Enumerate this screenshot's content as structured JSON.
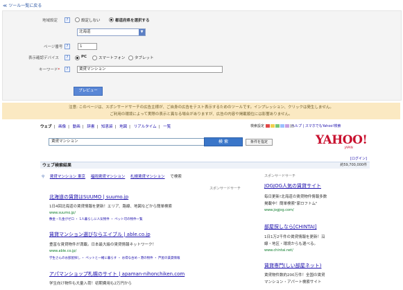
{
  "top_link": "≪ ツール一覧に戻る",
  "form": {
    "region_label": "地域設定",
    "region_opt_none": "設定しない",
    "region_opt_select": "都道府県を選択する",
    "prefecture_value": "北海道",
    "page_label": "ページ番号",
    "page_value": "1",
    "device_label": "表示確認デバイス",
    "device_pc": "PC",
    "device_sp": "スマートフォン",
    "device_tab": "タブレット",
    "keyword_label": "キーワード",
    "keyword_required": "*",
    "keyword_value": "賃貸マンション",
    "preview_button": "プレビュー",
    "help_glyph": "?"
  },
  "notice": {
    "line1": "注意: このページは、スポンサードサーチの広告主様が、ご自身の広告をテスト表示するためのツールです。インプレッション、クリックは発生しません。",
    "line2": "ご利用の環境によって実際の表示と異なる場合がありますが、広告の内容や掲載順位には影響ありません。"
  },
  "yahoo": {
    "tabs": [
      "ウェブ",
      "画像",
      "動画",
      "辞書",
      "知恵袋",
      "地図",
      "リアルタイム",
      "一覧"
    ],
    "settings_label": "検索設定",
    "swatch_colors": [
      "#e04848",
      "#f0d050",
      "#78c878",
      "#9ac0ff",
      "#c8a0e0",
      "#c8c8c8"
    ],
    "header_links": [
      "ヘルプ",
      "スマホでもYahoo!検索"
    ],
    "search_value": "賃貸マンション",
    "search_button": "検 索",
    "condition_button": "条件を指定",
    "logo_text": "YAHOO!",
    "logo_sub": "JAPAN",
    "login_link": "[ログイン]",
    "results_title": "ウェブ検索結果",
    "results_count": "約59,700,000件",
    "related_icon": "search-icon",
    "related": [
      "賃貸マンション 東京",
      "福岡賃貸マンション",
      "札幌賃貸マンション",
      "で検索"
    ],
    "sponsor_label": "スポンサードサーチ",
    "ads": [
      {
        "title": "北海道の賃貸はSUUMO | suumo.jp",
        "desc": "1日4回北海道の賃貸情報を更新！エリア、路線、地図などから簡単検索",
        "url": "www.suumo.jp/",
        "sub": "敷金・礼金がゼロ ・ 1人暮らしに人気物件 ・ ペット可の物件一覧"
      },
      {
        "title": "賃貸マンション選びならエイブル | able.co.jp",
        "desc": "豊富な賃貸物件が満載。日本最大級の賃貸情報ネットワーク！",
        "url": "www.able.co.jp/",
        "sub": "学生さんのお部屋探し ・ ペットと一緒に暮らす ・ お得な古め・港の物件 ・ 芦屋の賃貸情報"
      },
      {
        "title": "アパマンショップ札幌のサイト | apaman-nihonchiken.com",
        "desc": "学生向け物件も大量入荷！初期費用も2万円から",
        "url": "",
        "sub": ""
      }
    ],
    "right_label": "スポンサードサーチ",
    "right_ads": [
      {
        "title": "JOGJOG人気の賃貸サイト",
        "desc1": "毎日更新!北海道の賃貸物件情報多数",
        "desc2": "掲載中！簡単検索\"家ロフトム\"",
        "url": "www.jogjog.com/"
      },
      {
        "title": "部屋探しなら[CHINTAI]",
        "desc1": "1日1万2千件の賃貸情報を更新！沿",
        "desc2": "線・地区・環境からも選べる。",
        "url": "www.chintai.net/"
      },
      {
        "title": "賃貸専門(しい部屋ネット)",
        "desc1": "賃貸物件数約200万件！全国の賃貸",
        "desc2": "マンション・アパート検索サイト",
        "url": ""
      }
    ]
  }
}
